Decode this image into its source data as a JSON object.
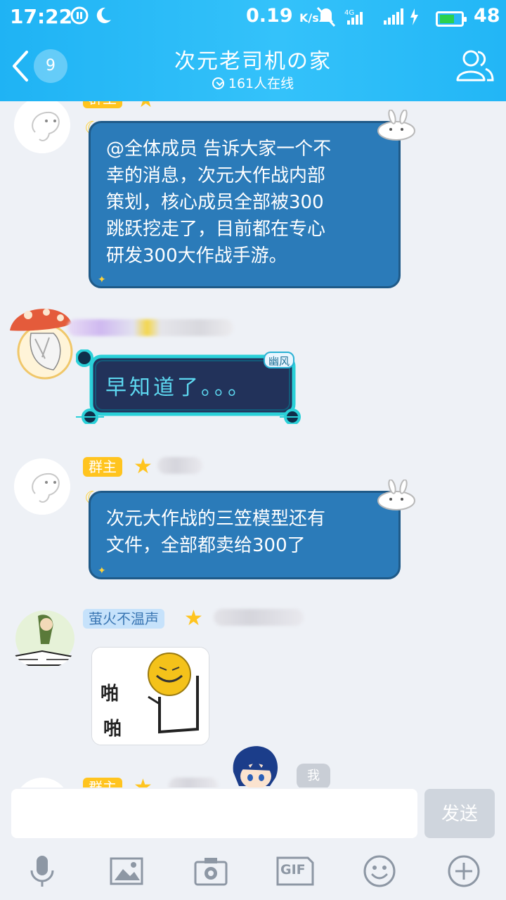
{
  "status_bar": {
    "time": "17:22",
    "speed": "0.19",
    "speed_unit": "K/s",
    "network": "4G",
    "battery_level": "48"
  },
  "header": {
    "unread_count": "9",
    "title": "次元老司机の家",
    "online": "161人在线"
  },
  "messages": [
    {
      "tag": "群主",
      "text_lines": [
        "@全体成员 告诉大家一个不",
        "幸的消息，次元大作战内部",
        "策划，核心成员全部被300",
        "跳跃挖走了，目前都在专心",
        "研发300大作战手游。"
      ]
    },
    {
      "sticker_text": "早知道了。。。",
      "sticker_badge": "幽风"
    },
    {
      "tag": "群主",
      "text_lines": [
        "次元大作战的三笠模型还有",
        "文件，全部都卖给300了"
      ]
    },
    {
      "tag": "萤火不温声",
      "sticker_caption": "啪\n啪"
    },
    {
      "tag": "群主",
      "me_label": "我"
    }
  ],
  "input": {
    "send_label": "发送",
    "gif_label": "GIF"
  },
  "colors": {
    "header": "#22b6f6",
    "bubble": "#2b7bb9",
    "owner_tag": "#ffc41f"
  }
}
